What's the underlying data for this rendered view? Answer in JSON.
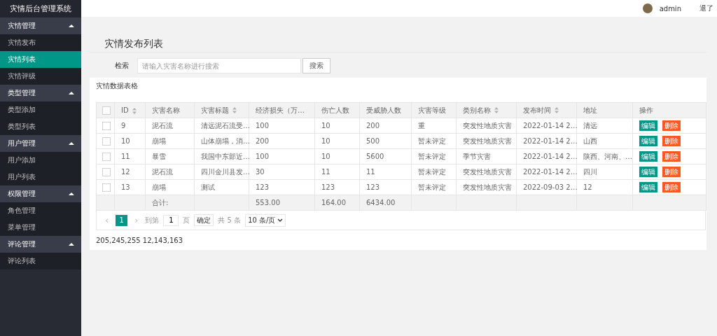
{
  "app_title": "灾情后台管理系统",
  "sidebar": {
    "groups": [
      {
        "label": "灾情管理",
        "expanded": true,
        "items": [
          {
            "label": "灾情发布",
            "selected": false
          },
          {
            "label": "灾情列表",
            "selected": true
          },
          {
            "label": "灾情评级",
            "selected": false
          }
        ]
      },
      {
        "label": "类型管理",
        "expanded": true,
        "items": [
          {
            "label": "类型添加",
            "selected": false
          },
          {
            "label": "类型列表",
            "selected": false
          }
        ]
      },
      {
        "label": "用户管理",
        "expanded": true,
        "items": [
          {
            "label": "用户添加",
            "selected": false
          },
          {
            "label": "用户列表",
            "selected": false
          }
        ]
      },
      {
        "label": "权限管理",
        "expanded": true,
        "items": [
          {
            "label": "角色管理",
            "selected": false
          },
          {
            "label": "菜单管理",
            "selected": false
          }
        ]
      },
      {
        "label": "评论管理",
        "expanded": true,
        "items": [
          {
            "label": "评论列表",
            "selected": false
          }
        ]
      }
    ]
  },
  "header": {
    "user": "admin",
    "logout": "退了"
  },
  "page_title": "灾情发布列表",
  "search": {
    "label": "检索",
    "placeholder": "请输入灾害名称进行搜索",
    "button": "搜索"
  },
  "card": {
    "title": "灾情数据表格",
    "table": {
      "header_checked": false,
      "columns": [
        {
          "label": "ID",
          "sortable": true
        },
        {
          "label": "灾害名称",
          "sortable": false
        },
        {
          "label": "灾害标题",
          "sortable": true
        },
        {
          "label": "经济损失（万…",
          "sortable": false
        },
        {
          "label": "伤亡人数",
          "sortable": false
        },
        {
          "label": "受威胁人数",
          "sortable": false
        },
        {
          "label": "灾害等级",
          "sortable": false
        },
        {
          "label": "类别名称",
          "sortable": true
        },
        {
          "label": "发布时间",
          "sortable": true
        },
        {
          "label": "地址",
          "sortable": false
        },
        {
          "label": "操作",
          "sortable": false
        }
      ],
      "rows": [
        {
          "checked": false,
          "cells": [
            "9",
            "泥石流",
            "清远泥石流受…",
            "100",
            "10",
            "200",
            "重",
            "突发性地质灾害",
            "2022-01-14 2…",
            "清远"
          ],
          "actions": [
            "编辑",
            "删除"
          ]
        },
        {
          "checked": false,
          "cells": [
            "10",
            "崩塌",
            "山体崩塌，消…",
            "200",
            "10",
            "500",
            "暂未评定",
            "突发性地质灾害",
            "2022-01-14 2…",
            "山西"
          ],
          "actions": [
            "编辑",
            "删除"
          ]
        },
        {
          "checked": false,
          "cells": [
            "11",
            "暴雪",
            "我国中东部近…",
            "100",
            "10",
            "5600",
            "暂未评定",
            "季节灾害",
            "2022-01-14 2…",
            "陕西、河南、…"
          ],
          "actions": [
            "编辑",
            "删除"
          ]
        },
        {
          "checked": false,
          "cells": [
            "12",
            "泥石流",
            "四川金川县发…",
            "30",
            "11",
            "11",
            "暂未评定",
            "突发性地质灾害",
            "2022-01-14 2…",
            "四川"
          ],
          "actions": [
            "编辑",
            "删除"
          ]
        },
        {
          "checked": false,
          "cells": [
            "13",
            "崩塌",
            "测试",
            "123",
            "123",
            "123",
            "暂未评定",
            "突发性地质灾害",
            "2022-09-03 2…",
            "12"
          ],
          "actions": [
            "编辑",
            "删除"
          ]
        }
      ],
      "totals": {
        "label": "合计:",
        "values": [
          "553.00",
          "164.00",
          "6434.00"
        ]
      }
    },
    "pagination": {
      "prev": "‹",
      "next": "›",
      "pages": [
        {
          "label": "1",
          "selected": true
        }
      ],
      "goto_label": "到第",
      "goto_value": "1",
      "page_unit": "页",
      "confirm": "确定",
      "total": "共 5 条",
      "page_size": "10 条/页"
    }
  },
  "footer_text": "205,245,255 12,143,163"
}
